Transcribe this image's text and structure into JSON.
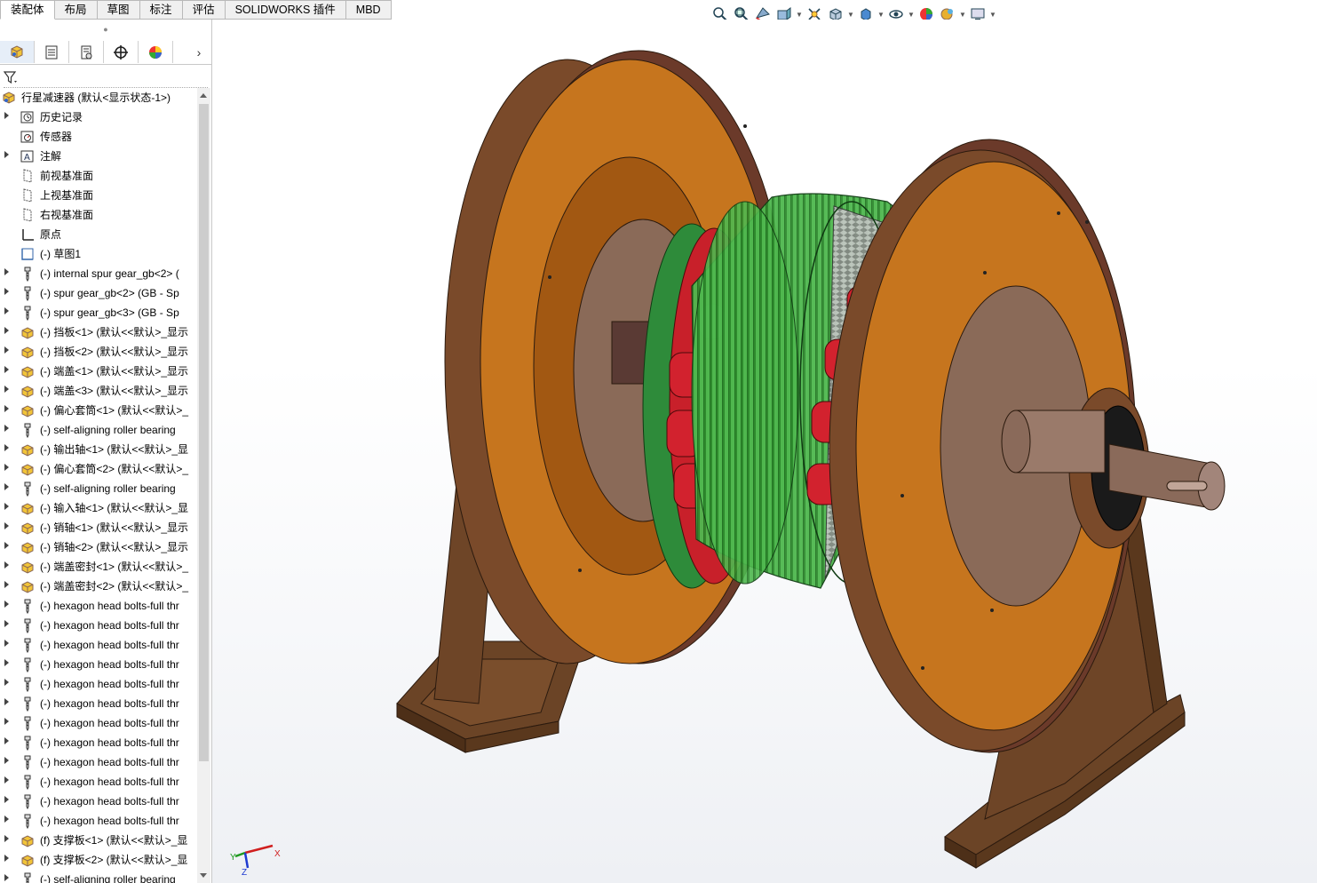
{
  "tabs": [
    {
      "label": "装配体",
      "active": true
    },
    {
      "label": "布局",
      "active": false
    },
    {
      "label": "草图",
      "active": false
    },
    {
      "label": "标注",
      "active": false
    },
    {
      "label": "评估",
      "active": false
    },
    {
      "label": "SOLIDWORKS 插件",
      "active": false
    },
    {
      "label": "MBD",
      "active": false
    }
  ],
  "hud_icons": [
    "zoom-to-fit-icon",
    "zoom-to-area-icon",
    "previous-view-icon",
    "section-view-icon",
    "dynamic-annotation-icon",
    "view-orientation-icon",
    "display-style-icon",
    "hide-show-icon",
    "edit-appearance-icon",
    "apply-scene-icon",
    "view-settings-icon"
  ],
  "panel_tabs": [
    "feature-manager-icon",
    "property-manager-icon",
    "configuration-manager-icon",
    "dimxpert-icon",
    "display-manager-icon"
  ],
  "tree": {
    "root": "行星减速器 (默认<显示状态-1>)",
    "items": [
      {
        "label": "历史记录",
        "icon": "history",
        "exp": true
      },
      {
        "label": "传感器",
        "icon": "sensor",
        "exp": false
      },
      {
        "label": "注解",
        "icon": "annotation",
        "exp": true
      },
      {
        "label": "前视基准面",
        "icon": "plane",
        "exp": false
      },
      {
        "label": "上视基准面",
        "icon": "plane",
        "exp": false
      },
      {
        "label": "右视基准面",
        "icon": "plane",
        "exp": false
      },
      {
        "label": "原点",
        "icon": "origin",
        "exp": false
      },
      {
        "label": "(-) 草图1",
        "icon": "sketch",
        "exp": false
      },
      {
        "label": "(-) internal spur gear_gb<2> (",
        "icon": "toolbox",
        "exp": true
      },
      {
        "label": "(-) spur gear_gb<2> (GB - Sp",
        "icon": "toolbox",
        "exp": true
      },
      {
        "label": "(-) spur gear_gb<3> (GB - Sp",
        "icon": "toolbox",
        "exp": true
      },
      {
        "label": "(-) 挡板<1> (默认<<默认>_显示",
        "icon": "part",
        "exp": true
      },
      {
        "label": "(-) 挡板<2> (默认<<默认>_显示",
        "icon": "part",
        "exp": true
      },
      {
        "label": "(-) 端盖<1> (默认<<默认>_显示",
        "icon": "part",
        "exp": true
      },
      {
        "label": "(-) 端盖<3> (默认<<默认>_显示",
        "icon": "part",
        "exp": true
      },
      {
        "label": "(-) 偏心套筒<1> (默认<<默认>_",
        "icon": "part",
        "exp": true
      },
      {
        "label": "(-) self-aligning roller bearing",
        "icon": "toolbox",
        "exp": true
      },
      {
        "label": "(-) 输出轴<1> (默认<<默认>_显",
        "icon": "part",
        "exp": true
      },
      {
        "label": "(-) 偏心套筒<2> (默认<<默认>_",
        "icon": "part",
        "exp": true
      },
      {
        "label": "(-) self-aligning roller bearing",
        "icon": "toolbox",
        "exp": true
      },
      {
        "label": "(-) 输入轴<1> (默认<<默认>_显",
        "icon": "part",
        "exp": true
      },
      {
        "label": "(-) 销轴<1> (默认<<默认>_显示",
        "icon": "part",
        "exp": true
      },
      {
        "label": "(-) 销轴<2> (默认<<默认>_显示",
        "icon": "part",
        "exp": true
      },
      {
        "label": "(-) 端盖密封<1> (默认<<默认>_",
        "icon": "part",
        "exp": true
      },
      {
        "label": "(-) 端盖密封<2> (默认<<默认>_",
        "icon": "part",
        "exp": true
      },
      {
        "label": "(-) hexagon head bolts-full thr",
        "icon": "toolbox",
        "exp": true
      },
      {
        "label": "(-) hexagon head bolts-full thr",
        "icon": "toolbox",
        "exp": true
      },
      {
        "label": "(-) hexagon head bolts-full thr",
        "icon": "toolbox",
        "exp": true
      },
      {
        "label": "(-) hexagon head bolts-full thr",
        "icon": "toolbox",
        "exp": true
      },
      {
        "label": "(-) hexagon head bolts-full thr",
        "icon": "toolbox",
        "exp": true
      },
      {
        "label": "(-) hexagon head bolts-full thr",
        "icon": "toolbox",
        "exp": true
      },
      {
        "label": "(-) hexagon head bolts-full thr",
        "icon": "toolbox",
        "exp": true
      },
      {
        "label": "(-) hexagon head bolts-full thr",
        "icon": "toolbox",
        "exp": true
      },
      {
        "label": "(-) hexagon head bolts-full thr",
        "icon": "toolbox",
        "exp": true
      },
      {
        "label": "(-) hexagon head bolts-full thr",
        "icon": "toolbox",
        "exp": true
      },
      {
        "label": "(-) hexagon head bolts-full thr",
        "icon": "toolbox",
        "exp": true
      },
      {
        "label": "(-) hexagon head bolts-full thr",
        "icon": "toolbox",
        "exp": true
      },
      {
        "label": "(f) 支撑板<1> (默认<<默认>_显",
        "icon": "part",
        "exp": true
      },
      {
        "label": "(f) 支撑板<2> (默认<<默认>_显",
        "icon": "part",
        "exp": true
      },
      {
        "label": "(-) self-aligning roller bearing",
        "icon": "toolbox",
        "exp": true
      }
    ]
  },
  "triad": {
    "x": "X",
    "y": "Y",
    "z": "Z"
  }
}
